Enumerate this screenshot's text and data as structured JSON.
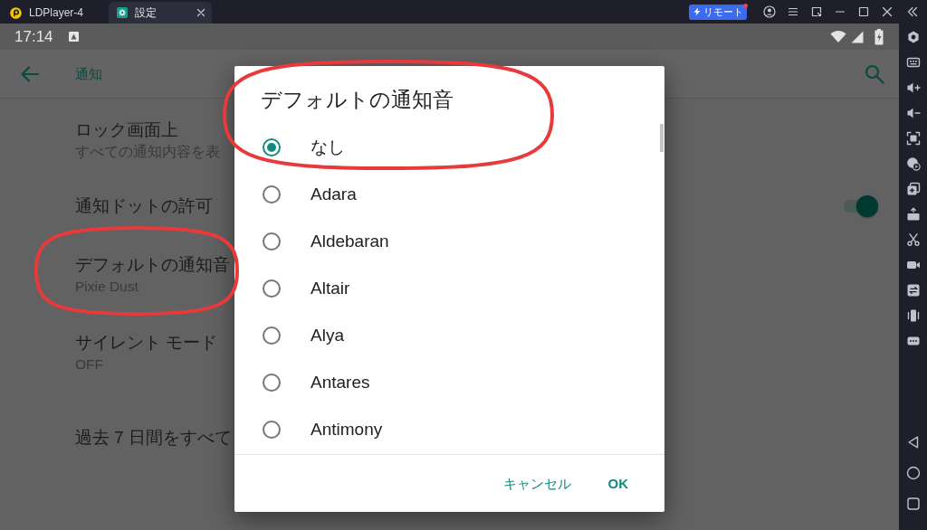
{
  "window": {
    "tabs": [
      {
        "label": "LDPlayer-4",
        "kind": "app",
        "selected": false
      },
      {
        "label": "設定",
        "kind": "settings",
        "selected": true
      }
    ],
    "remote_button": {
      "label": "リモート",
      "badge": true
    }
  },
  "status_bar": {
    "time": "17:14"
  },
  "app_bar": {
    "title": "通知"
  },
  "settings": [
    {
      "kind": "text",
      "title": "ロック画面上",
      "summary": "すべての通知内容を表"
    },
    {
      "kind": "switch",
      "title": "通知ドットの許可",
      "on": true
    },
    {
      "kind": "text",
      "title": "デフォルトの通知音",
      "summary": "Pixie Dust"
    },
    {
      "kind": "text",
      "title": "サイレント モード",
      "summary": "OFF"
    },
    {
      "kind": "text",
      "title": "過去 7 日間をすべて"
    }
  ],
  "dialog": {
    "title": "デフォルトの通知音",
    "options": [
      {
        "label": "なし",
        "selected": true
      },
      {
        "label": "Adara",
        "selected": false
      },
      {
        "label": "Aldebaran",
        "selected": false
      },
      {
        "label": "Altair",
        "selected": false
      },
      {
        "label": "Alya",
        "selected": false
      },
      {
        "label": "Antares",
        "selected": false
      },
      {
        "label": "Antimony",
        "selected": false
      }
    ],
    "buttons": [
      {
        "label": "キャンセル",
        "kind": "default"
      },
      {
        "label": "OK",
        "kind": "primary"
      }
    ]
  }
}
